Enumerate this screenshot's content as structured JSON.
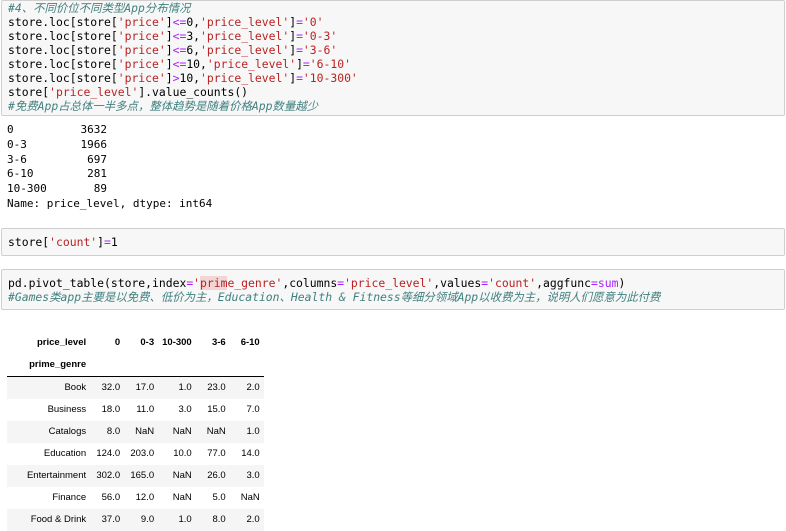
{
  "cell1": {
    "comment_top": "#4、不同价位不同类型App分布情况",
    "comment_bottom": "#免费App占总体一半多点，整体趋势是随着价格App数量越少",
    "value_counts_line": "store['price_level'].value_counts()"
  },
  "output1": {
    "rows": [
      {
        "label": "0",
        "value": "3632"
      },
      {
        "label": "0-3",
        "value": "1966"
      },
      {
        "label": "3-6",
        "value": "697"
      },
      {
        "label": "6-10",
        "value": "281"
      },
      {
        "label": "10-300",
        "value": "89"
      }
    ],
    "footer": "Name: price_level, dtype: int64"
  },
  "cell2": {
    "code": "store['count']=1"
  },
  "cell3": {
    "comment": "#Games类app主要是以免费、低价为主，Education、Health & Fitness等细分领域App以收费为主，说明人们愿意为此付费"
  },
  "table": {
    "columns_name": "price_level",
    "index_name": "prime_genre",
    "columns": [
      "0",
      "0-3",
      "10-300",
      "3-6",
      "6-10"
    ],
    "rows": [
      {
        "genre": "Book",
        "vals": [
          "32.0",
          "17.0",
          "1.0",
          "23.0",
          "2.0"
        ]
      },
      {
        "genre": "Business",
        "vals": [
          "18.0",
          "11.0",
          "3.0",
          "15.0",
          "7.0"
        ]
      },
      {
        "genre": "Catalogs",
        "vals": [
          "8.0",
          "NaN",
          "NaN",
          "NaN",
          "1.0"
        ]
      },
      {
        "genre": "Education",
        "vals": [
          "124.0",
          "203.0",
          "10.0",
          "77.0",
          "14.0"
        ]
      },
      {
        "genre": "Entertainment",
        "vals": [
          "302.0",
          "165.0",
          "NaN",
          "26.0",
          "3.0"
        ]
      },
      {
        "genre": "Finance",
        "vals": [
          "56.0",
          "12.0",
          "NaN",
          "5.0",
          "NaN"
        ]
      },
      {
        "genre": "Food & Drink",
        "vals": [
          "37.0",
          "9.0",
          "1.0",
          "8.0",
          "2.0"
        ]
      }
    ]
  }
}
